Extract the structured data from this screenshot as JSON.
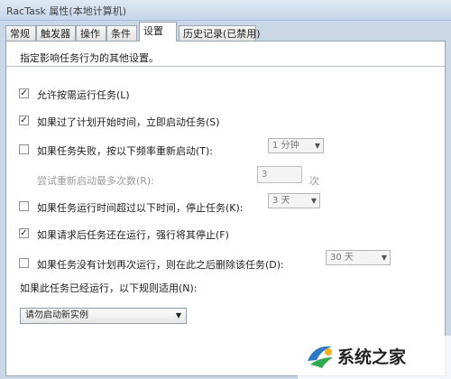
{
  "window": {
    "title": "RacTask 属性(本地计算机)"
  },
  "tabs": [
    {
      "label": "常规"
    },
    {
      "label": "触发器"
    },
    {
      "label": "操作"
    },
    {
      "label": "条件"
    },
    {
      "label": "设置",
      "active": true
    },
    {
      "label": "历史记录(已禁用)"
    }
  ],
  "settings": {
    "description": "指定影响任务行为的其他设置。",
    "options": [
      {
        "label": "允许按需运行任务(L)",
        "checked": true
      },
      {
        "label": "如果过了计划开始时间，立即启动任务(S)",
        "checked": true
      },
      {
        "label": "如果任务失败，按以下频率重新启动(T):",
        "checked": false
      },
      {
        "label": "如果任务运行时间超过以下时间，停止任务(K):",
        "checked": false
      },
      {
        "label": "如果请求后任务还在运行，强行将其停止(F)",
        "checked": true
      },
      {
        "label": "如果任务没有计划再次运行，则在此之后删除该任务(D):",
        "checked": false
      }
    ],
    "restart_interval": "1 分钟",
    "retry_label": "尝试重新启动最多次数(R):",
    "retry_count": "3",
    "retry_unit": "次",
    "stop_after": "3 天",
    "delete_after": "30 天",
    "running_rule_label": "如果此任务已经运行，以下规则适用(N):",
    "running_rule_value": "请勿启动新实例"
  },
  "watermark": {
    "text": "系统之家"
  }
}
